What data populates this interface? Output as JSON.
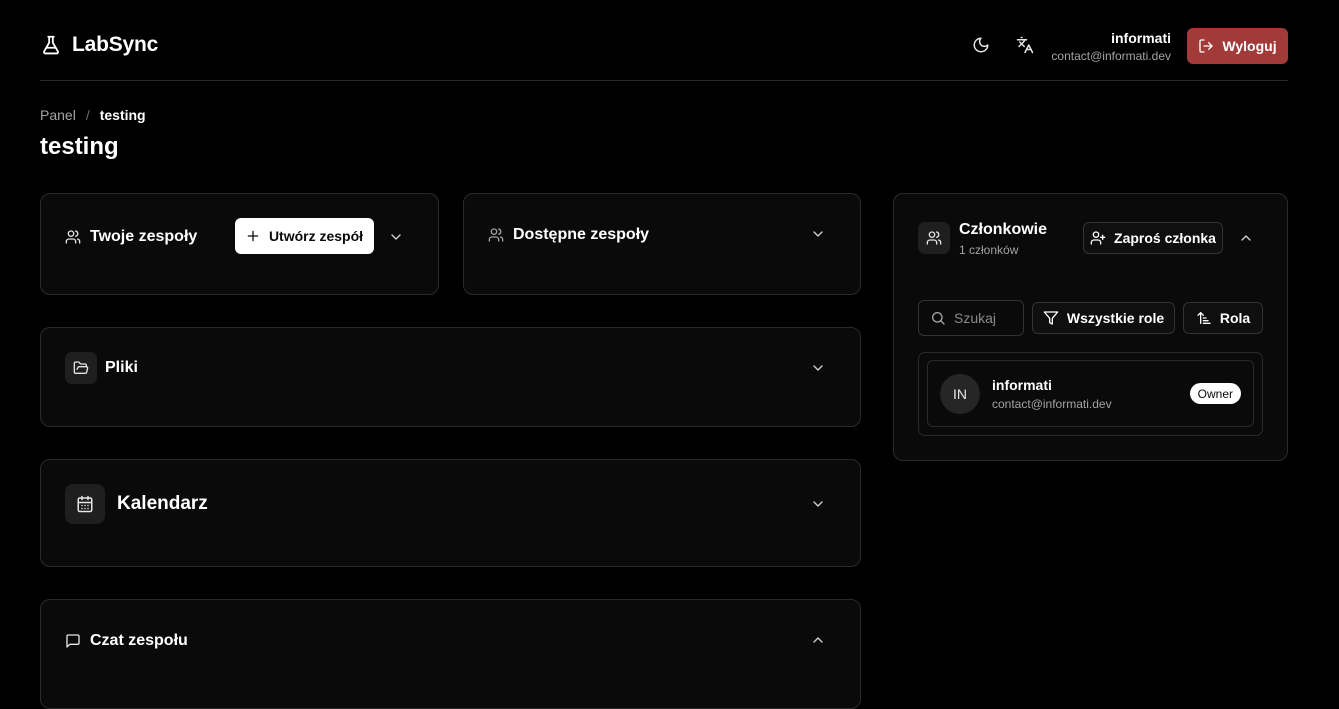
{
  "header": {
    "app_name": "LabSync",
    "user_name": "informati",
    "user_email": "contact@informati.dev",
    "logout_label": "Wyloguj",
    "icons": [
      "flask-icon",
      "moon-icon",
      "translate-icon",
      "logout-icon"
    ]
  },
  "breadcrumb": {
    "root": "Panel",
    "separator": "/",
    "current": "testing"
  },
  "page": {
    "title": "testing"
  },
  "cards": {
    "your_teams": {
      "title": "Twoje zespoły",
      "create_label": "Utwórz zespół"
    },
    "available_teams": {
      "title": "Dostępne zespoły"
    },
    "files": {
      "title": "Pliki"
    },
    "calendar": {
      "title": "Kalendarz"
    },
    "chat": {
      "title": "Czat zespołu"
    }
  },
  "members": {
    "title": "Członkowie",
    "count_text": "1 członków",
    "invite_label": "Zaproś członka",
    "search_placeholder": "Szukaj",
    "role_filter_label": "Wszystkie role",
    "sort_label": "Rola",
    "list": [
      {
        "initials": "IN",
        "name": "informati",
        "email": "contact@informati.dev",
        "role": "Owner"
      }
    ]
  },
  "colors": {
    "background": "#000000",
    "card": "#0a0a0a",
    "border": "#2a2a2a",
    "logout": "#a23a3a"
  }
}
